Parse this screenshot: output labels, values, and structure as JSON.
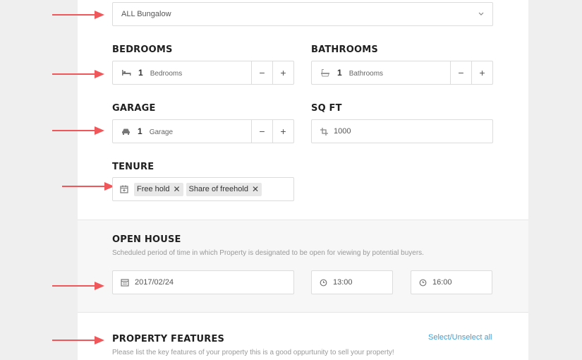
{
  "property_type": {
    "value": "ALL Bungalow"
  },
  "bedrooms": {
    "label": "BEDROOMS",
    "count": "1",
    "unit": "Bedrooms",
    "minus": "−",
    "plus": "+"
  },
  "bathrooms": {
    "label": "BATHROOMS",
    "count": "1",
    "unit": "Bathrooms",
    "minus": "−",
    "plus": "+"
  },
  "garage": {
    "label": "GARAGE",
    "count": "1",
    "unit": "Garage",
    "minus": "−",
    "plus": "+"
  },
  "sqft": {
    "label": "SQ FT",
    "value": "1000"
  },
  "tenure": {
    "label": "TENURE",
    "chips": [
      "Free hold",
      "Share of freehold"
    ],
    "remove": "✕"
  },
  "open_house": {
    "title": "OPEN HOUSE",
    "description": "Scheduled period of time in which Property is designated to be open for viewing by potential buyers.",
    "date": "2017/02/24",
    "start_time": "13:00",
    "end_time": "16:00"
  },
  "features": {
    "title": "PROPERTY FEATURES",
    "select_all": "Select/Unselect all",
    "description": "Please list the key features of your property this is a good oppurtunity to sell your property!"
  },
  "colors": {
    "arrow": "#f0575b",
    "link": "#3ba1da"
  }
}
